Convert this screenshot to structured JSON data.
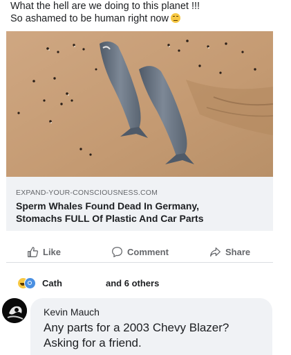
{
  "post": {
    "text_line1": "What the hell are we doing to this planet !!!",
    "text_line2": "So ashamed to be human right now",
    "emoji": "grimacing-face-emoji"
  },
  "link_card": {
    "domain": "EXPAND-YOUR-CONSCIOUSNESS.COM",
    "headline_line1": "Sperm Whales Found Dead In Germany,",
    "headline_line2": "Stomachs FULL Of Plastic And Car Parts",
    "image_description_icon": "beached-whales-photo"
  },
  "actions": {
    "like_label": "Like",
    "comment_label": "Comment",
    "share_label": "Share",
    "like_icon": "thumbs-up-icon",
    "comment_icon": "speech-bubble-icon",
    "share_icon": "share-arrow-icon"
  },
  "reactions": {
    "icons": [
      "laugh-reaction-icon",
      "sad-reaction-icon"
    ],
    "name": "Cath",
    "others": "and 6 others"
  },
  "comment": {
    "author": "Kevin Mauch",
    "text_line1": "Any parts for a 2003 Chevy Blazer?",
    "text_line2": "Asking for a friend."
  },
  "colors": {
    "text_primary": "#1c1e21",
    "text_secondary": "#65676b",
    "card_background": "#f0f2f5",
    "sand": "#c9a27a",
    "whale": "#6f7a86"
  }
}
